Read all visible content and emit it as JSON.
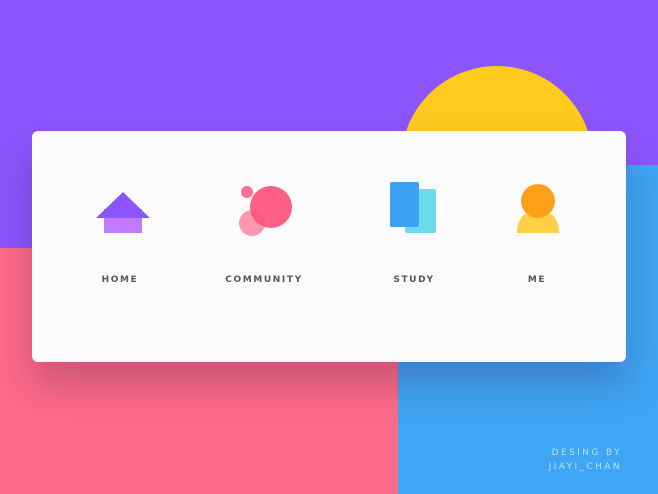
{
  "colors": {
    "purple": "#8c55fe",
    "pink": "#ff6a88",
    "blue": "#3ea6f5",
    "sun": "#ffcb1f",
    "card": "#fbfbfb",
    "home_roof": "#8c55fe",
    "home_body": "#c07aff",
    "community_big": "#ff527a",
    "community_small": "#ff6f96",
    "community_soft": "#ff98ae",
    "study_front": "#3aa2f0",
    "study_back": "#6ddaee",
    "me_head": "#ffa01a",
    "me_body": "#ffd046"
  },
  "tabs": [
    {
      "id": "home",
      "label": "HOME",
      "icon": "house-icon"
    },
    {
      "id": "community",
      "label": "COMMUNITY",
      "icon": "bubbles-icon"
    },
    {
      "id": "study",
      "label": "STUDY",
      "icon": "cards-icon"
    },
    {
      "id": "me",
      "label": "ME",
      "icon": "person-icon"
    }
  ],
  "credit": {
    "line1": "DESING  BY",
    "line2": "JIAYI_CHAN"
  }
}
